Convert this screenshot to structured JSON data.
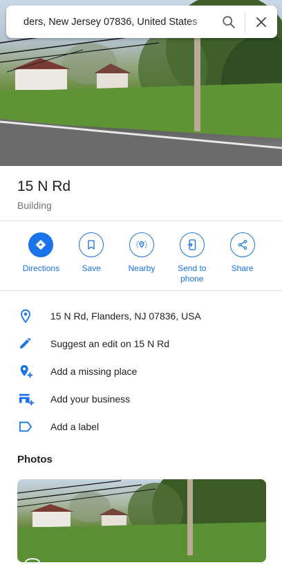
{
  "search": {
    "value": "ders, New Jersey 07836, United States"
  },
  "place": {
    "title": "15 N Rd",
    "category": "Building"
  },
  "actions": [
    {
      "label": "Directions",
      "icon": "directions-icon"
    },
    {
      "label": "Save",
      "icon": "bookmark-icon"
    },
    {
      "label": "Nearby",
      "icon": "nearby-icon"
    },
    {
      "label": "Send to phone",
      "icon": "send-to-phone-icon"
    },
    {
      "label": "Share",
      "icon": "share-icon"
    }
  ],
  "details": [
    {
      "text": "15 N Rd, Flanders, NJ 07836, USA",
      "icon": "location-pin-icon"
    },
    {
      "text": "Suggest an edit on 15 N Rd",
      "icon": "pencil-icon"
    },
    {
      "text": "Add a missing place",
      "icon": "add-place-icon"
    },
    {
      "text": "Add your business",
      "icon": "add-business-icon"
    },
    {
      "text": "Add a label",
      "icon": "label-icon"
    }
  ],
  "photos": {
    "heading": "Photos"
  },
  "colors": {
    "accent": "#1a73e8",
    "text": "#202124",
    "secondary": "#70757a"
  }
}
